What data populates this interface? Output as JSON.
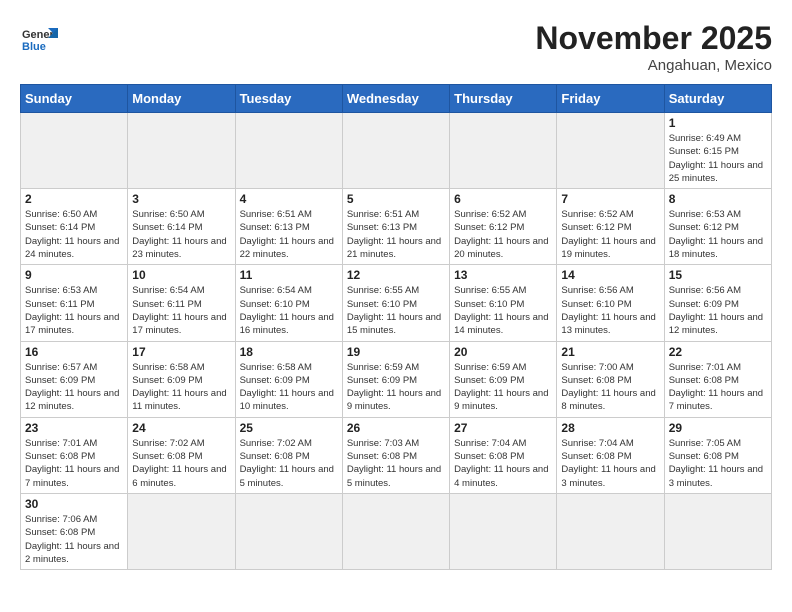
{
  "header": {
    "logo_general": "General",
    "logo_blue": "Blue",
    "month_title": "November 2025",
    "location": "Angahuan, Mexico"
  },
  "days_of_week": [
    "Sunday",
    "Monday",
    "Tuesday",
    "Wednesday",
    "Thursday",
    "Friday",
    "Saturday"
  ],
  "weeks": [
    [
      {
        "day": "",
        "info": ""
      },
      {
        "day": "",
        "info": ""
      },
      {
        "day": "",
        "info": ""
      },
      {
        "day": "",
        "info": ""
      },
      {
        "day": "",
        "info": ""
      },
      {
        "day": "",
        "info": ""
      },
      {
        "day": "1",
        "info": "Sunrise: 6:49 AM\nSunset: 6:15 PM\nDaylight: 11 hours\nand 25 minutes."
      }
    ],
    [
      {
        "day": "2",
        "info": "Sunrise: 6:50 AM\nSunset: 6:14 PM\nDaylight: 11 hours\nand 24 minutes."
      },
      {
        "day": "3",
        "info": "Sunrise: 6:50 AM\nSunset: 6:14 PM\nDaylight: 11 hours\nand 23 minutes."
      },
      {
        "day": "4",
        "info": "Sunrise: 6:51 AM\nSunset: 6:13 PM\nDaylight: 11 hours\nand 22 minutes."
      },
      {
        "day": "5",
        "info": "Sunrise: 6:51 AM\nSunset: 6:13 PM\nDaylight: 11 hours\nand 21 minutes."
      },
      {
        "day": "6",
        "info": "Sunrise: 6:52 AM\nSunset: 6:12 PM\nDaylight: 11 hours\nand 20 minutes."
      },
      {
        "day": "7",
        "info": "Sunrise: 6:52 AM\nSunset: 6:12 PM\nDaylight: 11 hours\nand 19 minutes."
      },
      {
        "day": "8",
        "info": "Sunrise: 6:53 AM\nSunset: 6:12 PM\nDaylight: 11 hours\nand 18 minutes."
      }
    ],
    [
      {
        "day": "9",
        "info": "Sunrise: 6:53 AM\nSunset: 6:11 PM\nDaylight: 11 hours\nand 17 minutes."
      },
      {
        "day": "10",
        "info": "Sunrise: 6:54 AM\nSunset: 6:11 PM\nDaylight: 11 hours\nand 17 minutes."
      },
      {
        "day": "11",
        "info": "Sunrise: 6:54 AM\nSunset: 6:10 PM\nDaylight: 11 hours\nand 16 minutes."
      },
      {
        "day": "12",
        "info": "Sunrise: 6:55 AM\nSunset: 6:10 PM\nDaylight: 11 hours\nand 15 minutes."
      },
      {
        "day": "13",
        "info": "Sunrise: 6:55 AM\nSunset: 6:10 PM\nDaylight: 11 hours\nand 14 minutes."
      },
      {
        "day": "14",
        "info": "Sunrise: 6:56 AM\nSunset: 6:10 PM\nDaylight: 11 hours\nand 13 minutes."
      },
      {
        "day": "15",
        "info": "Sunrise: 6:56 AM\nSunset: 6:09 PM\nDaylight: 11 hours\nand 12 minutes."
      }
    ],
    [
      {
        "day": "16",
        "info": "Sunrise: 6:57 AM\nSunset: 6:09 PM\nDaylight: 11 hours\nand 12 minutes."
      },
      {
        "day": "17",
        "info": "Sunrise: 6:58 AM\nSunset: 6:09 PM\nDaylight: 11 hours\nand 11 minutes."
      },
      {
        "day": "18",
        "info": "Sunrise: 6:58 AM\nSunset: 6:09 PM\nDaylight: 11 hours\nand 10 minutes."
      },
      {
        "day": "19",
        "info": "Sunrise: 6:59 AM\nSunset: 6:09 PM\nDaylight: 11 hours\nand 9 minutes."
      },
      {
        "day": "20",
        "info": "Sunrise: 6:59 AM\nSunset: 6:09 PM\nDaylight: 11 hours\nand 9 minutes."
      },
      {
        "day": "21",
        "info": "Sunrise: 7:00 AM\nSunset: 6:08 PM\nDaylight: 11 hours\nand 8 minutes."
      },
      {
        "day": "22",
        "info": "Sunrise: 7:01 AM\nSunset: 6:08 PM\nDaylight: 11 hours\nand 7 minutes."
      }
    ],
    [
      {
        "day": "23",
        "info": "Sunrise: 7:01 AM\nSunset: 6:08 PM\nDaylight: 11 hours\nand 7 minutes."
      },
      {
        "day": "24",
        "info": "Sunrise: 7:02 AM\nSunset: 6:08 PM\nDaylight: 11 hours\nand 6 minutes."
      },
      {
        "day": "25",
        "info": "Sunrise: 7:02 AM\nSunset: 6:08 PM\nDaylight: 11 hours\nand 5 minutes."
      },
      {
        "day": "26",
        "info": "Sunrise: 7:03 AM\nSunset: 6:08 PM\nDaylight: 11 hours\nand 5 minutes."
      },
      {
        "day": "27",
        "info": "Sunrise: 7:04 AM\nSunset: 6:08 PM\nDaylight: 11 hours\nand 4 minutes."
      },
      {
        "day": "28",
        "info": "Sunrise: 7:04 AM\nSunset: 6:08 PM\nDaylight: 11 hours\nand 3 minutes."
      },
      {
        "day": "29",
        "info": "Sunrise: 7:05 AM\nSunset: 6:08 PM\nDaylight: 11 hours\nand 3 minutes."
      }
    ],
    [
      {
        "day": "30",
        "info": "Sunrise: 7:06 AM\nSunset: 6:08 PM\nDaylight: 11 hours\nand 2 minutes."
      },
      {
        "day": "",
        "info": ""
      },
      {
        "day": "",
        "info": ""
      },
      {
        "day": "",
        "info": ""
      },
      {
        "day": "",
        "info": ""
      },
      {
        "day": "",
        "info": ""
      },
      {
        "day": "",
        "info": ""
      }
    ]
  ]
}
